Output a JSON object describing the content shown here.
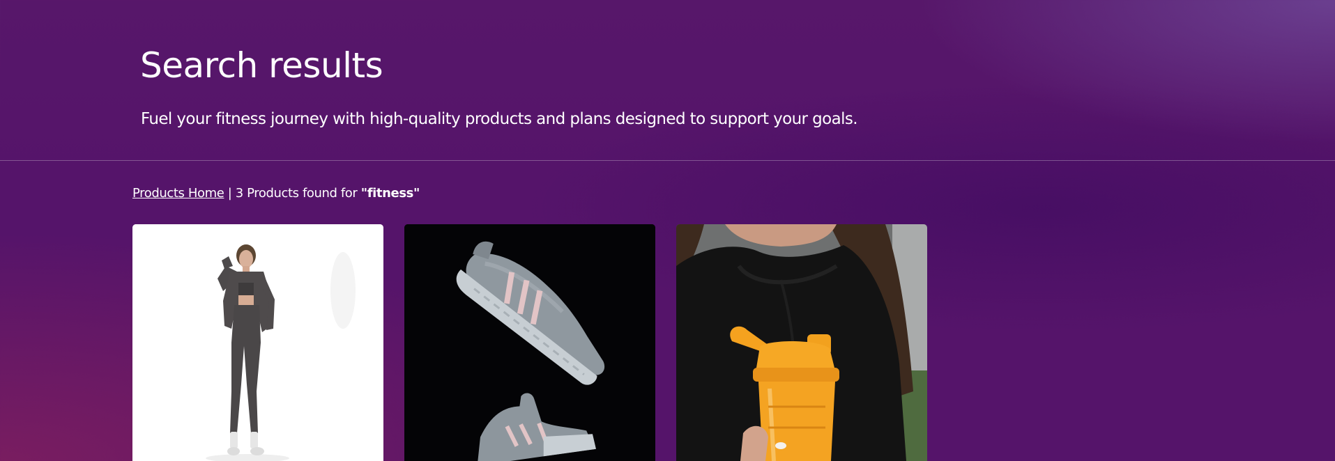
{
  "hero": {
    "title": "Search results",
    "subtitle": "Fuel your fitness journey with high-quality products and plans designed to support your goals."
  },
  "results": {
    "home_link": "Products Home",
    "separator": "|",
    "count_text": "3 Products found for",
    "query": "\"fitness\""
  },
  "products": [
    {
      "image": "woman-in-grey-activewear-photo"
    },
    {
      "image": "grey-running-shoes-photo"
    },
    {
      "image": "orange-shaker-bottle-photo"
    }
  ],
  "colors": {
    "background": "#55146a",
    "text": "#ffffff",
    "card_light": "#ffffff",
    "card_dark": "#040406"
  }
}
